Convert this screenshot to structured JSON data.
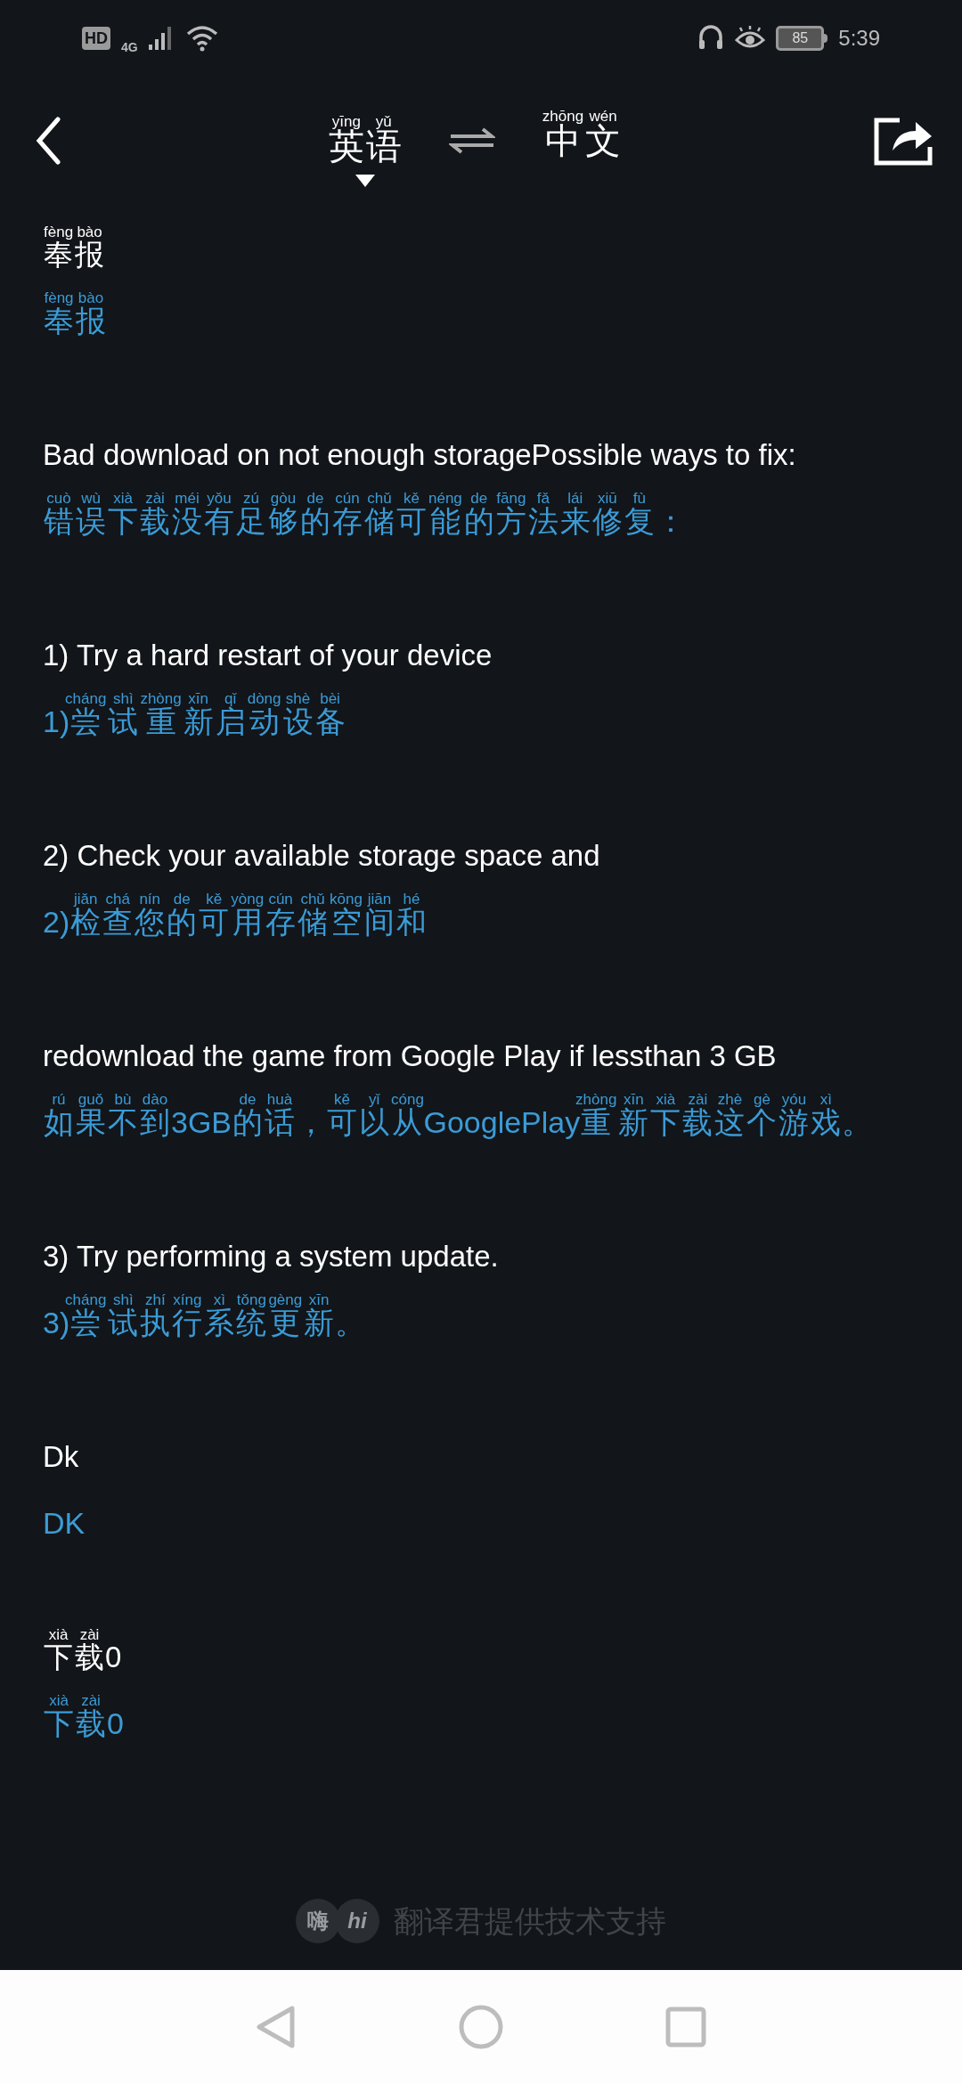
{
  "status_bar": {
    "hd": "HD",
    "network": "4G",
    "battery": "85",
    "time": "5:39"
  },
  "toolbar": {
    "source_language": [
      {
        "text": "英",
        "pinyin": "yīng"
      },
      {
        "text": "语",
        "pinyin": "yǔ"
      }
    ],
    "target_language": [
      {
        "text": "中",
        "pinyin": "zhōng"
      },
      {
        "text": "文",
        "pinyin": "wén"
      }
    ]
  },
  "entries": [
    {
      "source": [
        {
          "text": "奉",
          "pinyin": "fèng"
        },
        {
          "text": "报",
          "pinyin": "bào"
        }
      ],
      "translation": [
        {
          "text": "奉",
          "pinyin": "fèng"
        },
        {
          "text": "报",
          "pinyin": "bào"
        }
      ]
    },
    {
      "source": [
        {
          "text": "Bad download on not enough storagePossible ways to fix:"
        }
      ],
      "translation": [
        {
          "text": "错",
          "pinyin": "cuò"
        },
        {
          "text": "误",
          "pinyin": "wù"
        },
        {
          "text": "下",
          "pinyin": "xià"
        },
        {
          "text": "载",
          "pinyin": "zài"
        },
        {
          "text": "没",
          "pinyin": "méi"
        },
        {
          "text": "有",
          "pinyin": "yǒu"
        },
        {
          "text": "足",
          "pinyin": "zú"
        },
        {
          "text": "够",
          "pinyin": "gòu"
        },
        {
          "text": "的",
          "pinyin": "de"
        },
        {
          "text": "存",
          "pinyin": "cún"
        },
        {
          "text": "储",
          "pinyin": "chǔ"
        },
        {
          "text": "可",
          "pinyin": "kě"
        },
        {
          "text": "能",
          "pinyin": "néng"
        },
        {
          "text": "的",
          "pinyin": "de"
        },
        {
          "text": "方",
          "pinyin": "fāng"
        },
        {
          "text": "法",
          "pinyin": "fǎ"
        },
        {
          "text": "来",
          "pinyin": "lái"
        },
        {
          "text": "修",
          "pinyin": "xiū"
        },
        {
          "text": "复",
          "pinyin": "fù"
        },
        {
          "text": "："
        }
      ]
    },
    {
      "source": [
        {
          "text": "1) Try a hard restart of your device"
        }
      ],
      "translation": [
        {
          "text": "1)"
        },
        {
          "text": "尝",
          "pinyin": "cháng"
        },
        {
          "text": "试",
          "pinyin": "shì"
        },
        {
          "text": "重",
          "pinyin": "zhòng"
        },
        {
          "text": "新",
          "pinyin": "xīn"
        },
        {
          "text": "启",
          "pinyin": "qǐ"
        },
        {
          "text": "动",
          "pinyin": "dòng"
        },
        {
          "text": "设",
          "pinyin": "shè"
        },
        {
          "text": "备",
          "pinyin": "bèi"
        }
      ]
    },
    {
      "source": [
        {
          "text": "2) Check your available storage space and"
        }
      ],
      "translation": [
        {
          "text": "2)"
        },
        {
          "text": "检",
          "pinyin": "jiǎn"
        },
        {
          "text": "查",
          "pinyin": "chá"
        },
        {
          "text": "您",
          "pinyin": "nín"
        },
        {
          "text": "的",
          "pinyin": "de"
        },
        {
          "text": "可",
          "pinyin": "kě"
        },
        {
          "text": "用",
          "pinyin": "yòng"
        },
        {
          "text": "存",
          "pinyin": "cún"
        },
        {
          "text": "储",
          "pinyin": "chǔ"
        },
        {
          "text": "空",
          "pinyin": "kōng"
        },
        {
          "text": "间",
          "pinyin": "jiān"
        },
        {
          "text": "和",
          "pinyin": "hé"
        }
      ]
    },
    {
      "source": [
        {
          "text": "redownload the game from Google Play if lessthan 3 GB"
        }
      ],
      "translation": [
        {
          "text": "如",
          "pinyin": "rú"
        },
        {
          "text": "果",
          "pinyin": "guǒ"
        },
        {
          "text": "不",
          "pinyin": "bù"
        },
        {
          "text": "到",
          "pinyin": "dào"
        },
        {
          "text": "3GB"
        },
        {
          "text": "的",
          "pinyin": "de"
        },
        {
          "text": "话",
          "pinyin": "huà"
        },
        {
          "text": "，"
        },
        {
          "text": "可",
          "pinyin": "kě"
        },
        {
          "text": "以",
          "pinyin": "yǐ"
        },
        {
          "text": "从",
          "pinyin": "cóng"
        },
        {
          "text": "GooglePlay"
        },
        {
          "text": "重",
          "pinyin": "zhòng"
        },
        {
          "text": "新",
          "pinyin": "xīn"
        },
        {
          "text": "下",
          "pinyin": "xià"
        },
        {
          "text": "载",
          "pinyin": "zài"
        },
        {
          "text": "这",
          "pinyin": "zhè"
        },
        {
          "text": "个",
          "pinyin": "gè"
        },
        {
          "text": "游",
          "pinyin": "yóu"
        },
        {
          "text": "戏",
          "pinyin": "xì"
        },
        {
          "text": "。"
        }
      ]
    },
    {
      "source": [
        {
          "text": "3) Try performing a system update."
        }
      ],
      "translation": [
        {
          "text": "3)"
        },
        {
          "text": "尝",
          "pinyin": "cháng"
        },
        {
          "text": "试",
          "pinyin": "shì"
        },
        {
          "text": "执",
          "pinyin": "zhí"
        },
        {
          "text": "行",
          "pinyin": "xíng"
        },
        {
          "text": "系",
          "pinyin": "xì"
        },
        {
          "text": "统",
          "pinyin": "tǒng"
        },
        {
          "text": "更",
          "pinyin": "gèng"
        },
        {
          "text": "新",
          "pinyin": "xīn"
        },
        {
          "text": "。"
        }
      ]
    },
    {
      "source": [
        {
          "text": "Dk"
        }
      ],
      "translation": [
        {
          "text": "DK"
        }
      ]
    },
    {
      "source": [
        {
          "text": "下",
          "pinyin": "xià"
        },
        {
          "text": "载",
          "pinyin": "zài"
        },
        {
          "text": "0"
        }
      ],
      "translation": [
        {
          "text": "下",
          "pinyin": "xià"
        },
        {
          "text": "载",
          "pinyin": "zài"
        },
        {
          "text": "0"
        }
      ]
    }
  ],
  "footer": {
    "logo": [
      "嗨",
      "hi"
    ],
    "text": "翻译君提供技术支持"
  }
}
